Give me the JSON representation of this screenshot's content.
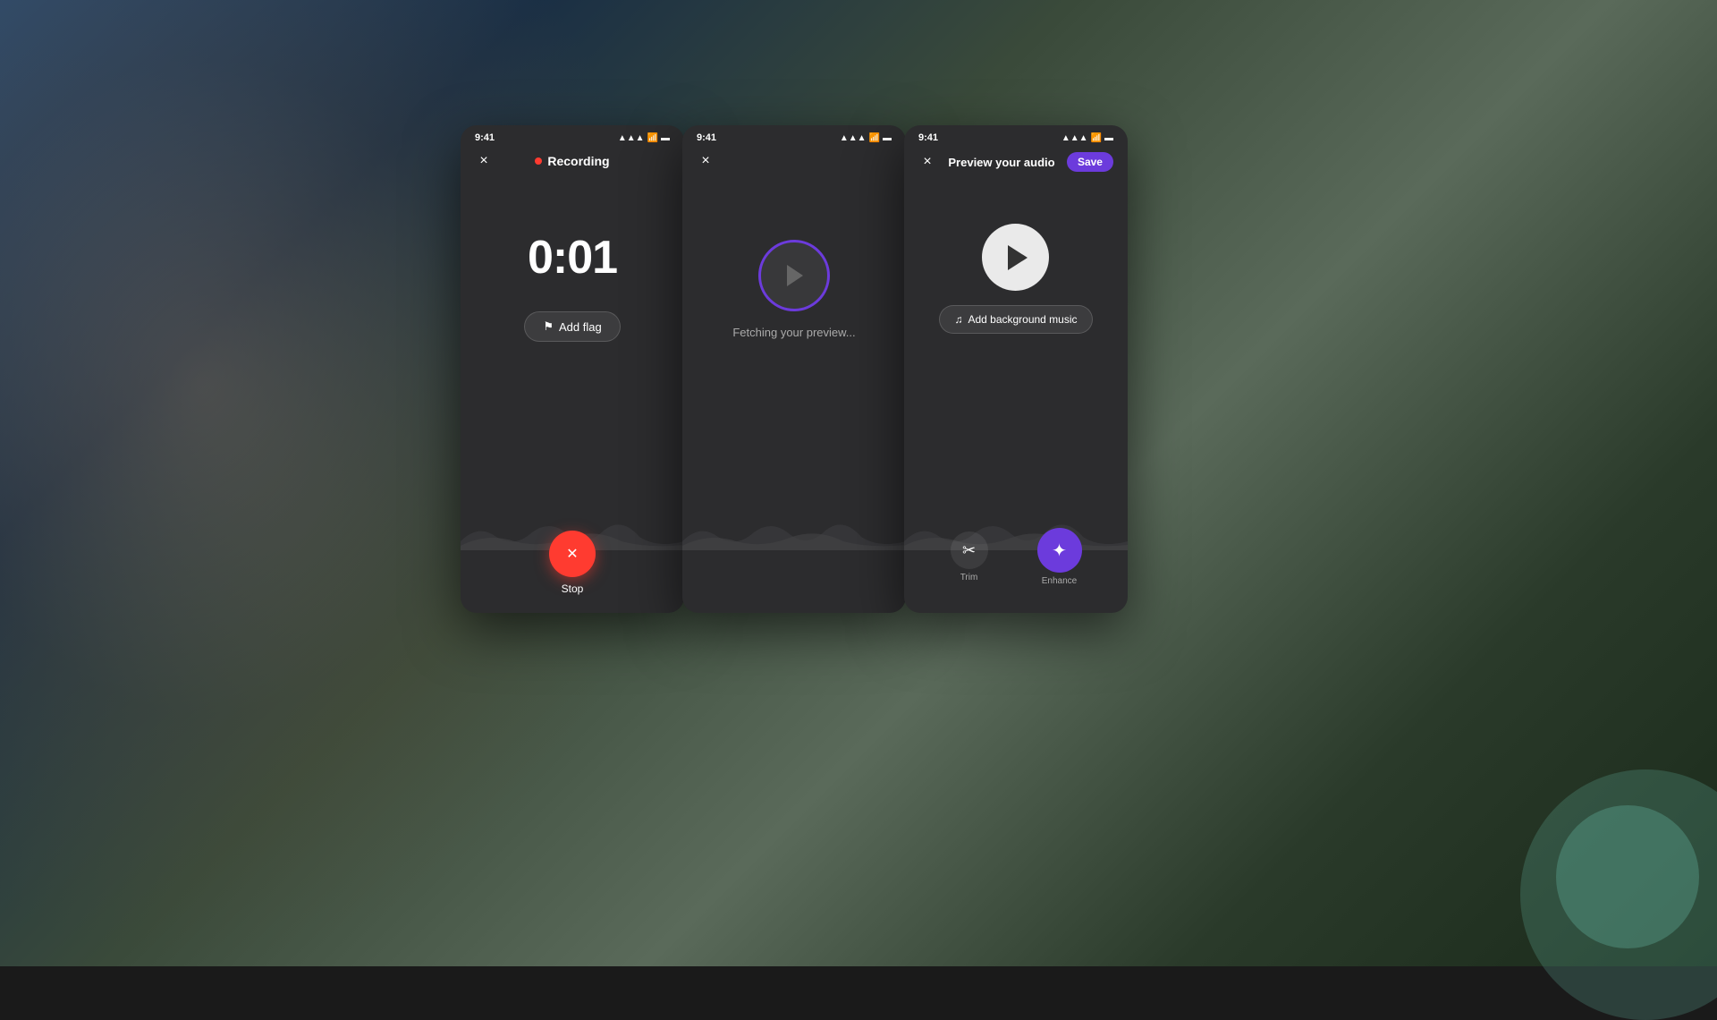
{
  "background": {
    "color": "#1a2030"
  },
  "phone1": {
    "status_time": "9:41",
    "signal_icon": "📶",
    "wifi_icon": "wifi",
    "battery_icon": "battery",
    "close_label": "×",
    "title": "Recording",
    "recording_indicator": "●",
    "timer": "0:01",
    "add_flag_label": "Add flag",
    "flag_icon": "⚑",
    "stop_label": "Stop"
  },
  "phone2": {
    "status_time": "9:41",
    "close_label": "×",
    "fetching_label": "Fetching your preview..."
  },
  "phone3": {
    "status_time": "9:41",
    "close_label": "×",
    "title": "Preview your audio",
    "save_label": "Save",
    "add_music_label": "Add background music",
    "music_icon": "♫",
    "trim_label": "Trim",
    "trim_icon": "✂",
    "enhance_label": "Enhance",
    "enhance_icon": "✦"
  },
  "colors": {
    "accent_purple": "#6c3bdc",
    "stop_red": "#ff3b30",
    "recording_red": "#ff3b30",
    "dark_bg": "#2c2c2e",
    "medium_bg": "#3a3a3c"
  }
}
